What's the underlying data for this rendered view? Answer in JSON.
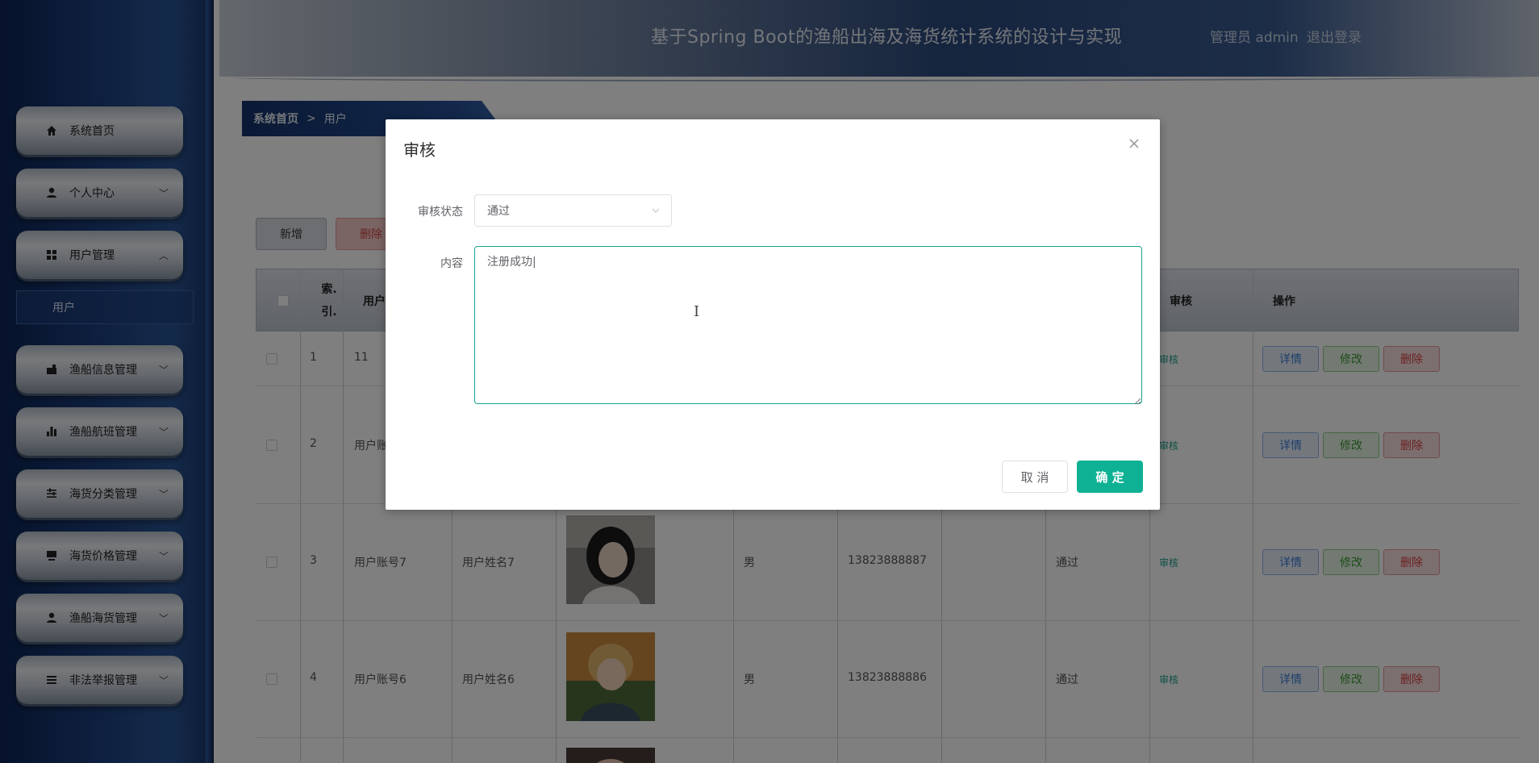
{
  "header": {
    "title": "基于Spring Boot的渔船出海及海货统计系统的设计与实现",
    "user": "管理员 admin",
    "logout": "退出登录"
  },
  "sidebar": {
    "items": [
      {
        "label": "系统首页",
        "icon": "home-icon",
        "chevron": ""
      },
      {
        "label": "个人中心",
        "icon": "user-icon",
        "chevron": "﹀"
      },
      {
        "label": "用户管理",
        "icon": "grid-icon",
        "chevron": "︿"
      },
      {
        "label": "渔船信息管理",
        "icon": "ship-icon",
        "chevron": "﹀"
      },
      {
        "label": "渔船航班管理",
        "icon": "bar-chart-icon",
        "chevron": "﹀"
      },
      {
        "label": "海货分类管理",
        "icon": "sliders-icon",
        "chevron": "﹀"
      },
      {
        "label": "海货价格管理",
        "icon": "monitor-icon",
        "chevron": "﹀"
      },
      {
        "label": "渔船海货管理",
        "icon": "user-icon",
        "chevron": "﹀"
      },
      {
        "label": "非法举报管理",
        "icon": "list-icon",
        "chevron": "﹀"
      }
    ],
    "submenu": {
      "label": "用户"
    }
  },
  "breadcrumb": {
    "home": "系统首页",
    "separator": ">",
    "current": "用户"
  },
  "actions": {
    "add": "新增",
    "delete": "删除"
  },
  "table": {
    "headers": {
      "checkbox": "",
      "index": "索.\n引.",
      "account": "用户",
      "audit": "审核",
      "operation": "操作"
    },
    "rows": [
      {
        "index": "1",
        "account": "11",
        "name": "",
        "gender": "",
        "phone": "",
        "status": "",
        "audit": "审核"
      },
      {
        "index": "2",
        "account": "用户账",
        "name": "",
        "gender": "",
        "phone": "",
        "status": "",
        "audit": "审核"
      },
      {
        "index": "3",
        "account": "用户账号7",
        "name": "用户姓名7",
        "gender": "男",
        "phone": "13823888887",
        "status": "通过",
        "audit": "审核"
      },
      {
        "index": "4",
        "account": "用户账号6",
        "name": "用户姓名6",
        "gender": "男",
        "phone": "13823888886",
        "status": "通过",
        "audit": "审核"
      }
    ],
    "row_actions": {
      "detail": "详情",
      "edit": "修改",
      "delete": "删除"
    }
  },
  "modal": {
    "title": "审核",
    "status_label": "审核状态",
    "status_value": "通过",
    "content_label": "内容",
    "content_value": "注册成功|",
    "cancel": "取 消",
    "confirm": "确 定"
  },
  "colors": {
    "accent": "#0fb194",
    "sidebar": "#1c3f7e",
    "header": "#2c4a7d"
  }
}
